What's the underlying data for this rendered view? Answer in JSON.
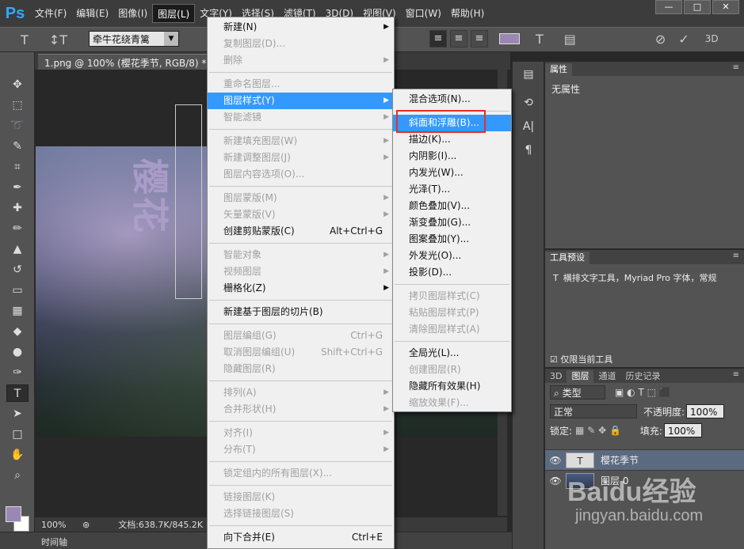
{
  "app": {
    "logo": "Ps",
    "menu": [
      "文件(F)",
      "编辑(E)",
      "图像(I)",
      "图层(L)",
      "文字(Y)",
      "选择(S)",
      "滤镜(T)",
      "3D(D)",
      "视图(V)",
      "窗口(W)",
      "帮助(H)"
    ],
    "active_menu": "图层(L)",
    "window_controls": [
      "—",
      "□",
      "✕"
    ]
  },
  "options_bar": {
    "tool_glyph": "T",
    "orient_glyph": "↕T",
    "font_family": "牵牛花绕青篱",
    "align_left": "≡",
    "align_center": "≡",
    "align_right": "≡",
    "text_color": "#9a88b4",
    "warp_icon": "T",
    "panels_icon": "▤",
    "cancel_icon": "⊘",
    "commit_icon": "✓",
    "mode_3d": "3D"
  },
  "document": {
    "tab_title": "1.png @ 100% (樱花季节, RGB/8) *",
    "tab_close": "×",
    "layer_text": "樱花",
    "zoom": "100%",
    "doc_info": "文档:638.7K/845.2K",
    "timeline": "时间轴"
  },
  "layer_menu": {
    "items": [
      {
        "label": "新建(N)",
        "arrow": true,
        "disabled": false
      },
      {
        "label": "复制图层(D)...",
        "disabled": true
      },
      {
        "label": "删除",
        "arrow": true,
        "disabled": true
      },
      {
        "sep": true
      },
      {
        "label": "重命名图层...",
        "disabled": true
      },
      {
        "label": "图层样式(Y)",
        "arrow": true,
        "highlight": true
      },
      {
        "label": "智能滤镜",
        "arrow": true,
        "disabled": true
      },
      {
        "sep": true
      },
      {
        "label": "新建填充图层(W)",
        "arrow": true,
        "disabled": true
      },
      {
        "label": "新建调整图层(J)",
        "arrow": true,
        "disabled": true
      },
      {
        "label": "图层内容选项(O)...",
        "disabled": true
      },
      {
        "sep": true
      },
      {
        "label": "图层蒙版(M)",
        "arrow": true,
        "disabled": true
      },
      {
        "label": "矢量蒙版(V)",
        "arrow": true,
        "disabled": true
      },
      {
        "label": "创建剪贴蒙版(C)",
        "shortcut": "Alt+Ctrl+G"
      },
      {
        "sep": true
      },
      {
        "label": "智能对象",
        "arrow": true,
        "disabled": true
      },
      {
        "label": "视频图层",
        "arrow": true,
        "disabled": true
      },
      {
        "label": "栅格化(Z)",
        "arrow": true
      },
      {
        "sep": true
      },
      {
        "label": "新建基于图层的切片(B)"
      },
      {
        "sep": true
      },
      {
        "label": "图层编组(G)",
        "shortcut": "Ctrl+G",
        "disabled": true
      },
      {
        "label": "取消图层编组(U)",
        "shortcut": "Shift+Ctrl+G",
        "disabled": true
      },
      {
        "label": "隐藏图层(R)",
        "disabled": true
      },
      {
        "sep": true
      },
      {
        "label": "排列(A)",
        "arrow": true,
        "disabled": true
      },
      {
        "label": "合并形状(H)",
        "arrow": true,
        "disabled": true
      },
      {
        "sep": true
      },
      {
        "label": "对齐(I)",
        "arrow": true,
        "disabled": true
      },
      {
        "label": "分布(T)",
        "arrow": true,
        "disabled": true
      },
      {
        "sep": true
      },
      {
        "label": "锁定组内的所有图层(X)...",
        "disabled": true
      },
      {
        "sep": true
      },
      {
        "label": "链接图层(K)",
        "disabled": true
      },
      {
        "label": "选择链接图层(S)",
        "disabled": true
      },
      {
        "sep": true
      },
      {
        "label": "向下合并(E)",
        "shortcut": "Ctrl+E"
      }
    ]
  },
  "style_menu": {
    "items": [
      {
        "label": "混合选项(N)..."
      },
      {
        "sep": true
      },
      {
        "label": "斜面和浮雕(B)...",
        "highlight": true
      },
      {
        "label": "描边(K)..."
      },
      {
        "label": "内阴影(I)..."
      },
      {
        "label": "内发光(W)..."
      },
      {
        "label": "光泽(T)..."
      },
      {
        "label": "颜色叠加(V)..."
      },
      {
        "label": "渐变叠加(G)..."
      },
      {
        "label": "图案叠加(Y)..."
      },
      {
        "label": "外发光(O)..."
      },
      {
        "label": "投影(D)..."
      },
      {
        "sep": true
      },
      {
        "label": "拷贝图层样式(C)",
        "disabled": true
      },
      {
        "label": "粘贴图层样式(P)",
        "disabled": true
      },
      {
        "label": "清除图层样式(A)",
        "disabled": true
      },
      {
        "sep": true
      },
      {
        "label": "全局光(L)..."
      },
      {
        "label": "创建图层(R)",
        "disabled": true
      },
      {
        "label": "隐藏所有效果(H)"
      },
      {
        "label": "缩放效果(F)...",
        "disabled": true
      }
    ],
    "highlight_color": "#3399ff",
    "callout_color": "#e03030"
  },
  "properties_panel": {
    "tab": "属性",
    "content": "无属性"
  },
  "tool_presets_panel": {
    "tab": "工具预设",
    "preset": "横排文字工具，Myriad Pro 字体，常规",
    "checkbox_label": "仅限当前工具",
    "checked": true
  },
  "layers_panel": {
    "tabs": [
      "3D",
      "图层",
      "通道",
      "历史记录"
    ],
    "active_tab": "图层",
    "filter_label": "类型",
    "blend_mode": "正常",
    "opacity_label": "不透明度:",
    "opacity": "100%",
    "lock_label": "锁定:",
    "fill_label": "填充:",
    "fill": "100%",
    "layers": [
      {
        "name": "樱花季节",
        "type": "text",
        "thumb": "T",
        "selected": true
      },
      {
        "name": "图层 0",
        "type": "image",
        "selected": false
      }
    ]
  },
  "watermark": {
    "logo": "Baidu经验",
    "url": "jingyan.baidu.com"
  }
}
